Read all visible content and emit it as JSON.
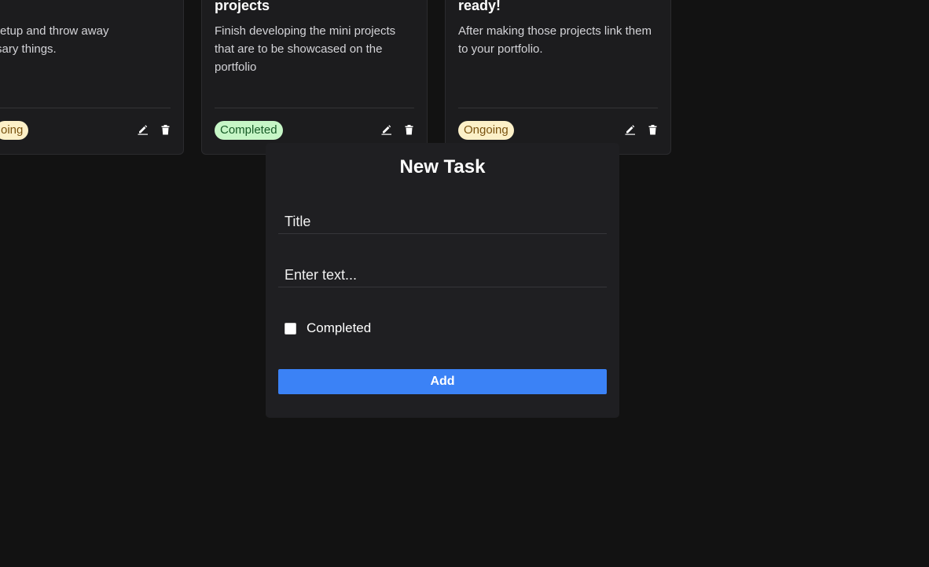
{
  "cards": [
    {
      "title": "",
      "description": "n the setup and throw away\nnecessary things.",
      "status": "oing",
      "status_type": "ongoing"
    },
    {
      "title": "projects",
      "description": "Finish developing the mini projects that are to be showcased on the portfolio",
      "status": "Completed",
      "status_type": "completed"
    },
    {
      "title": "ready!",
      "description": "After making those projects link them to your portfolio.",
      "status": "Ongoing",
      "status_type": "ongoing"
    }
  ],
  "icons": {
    "edit": "pencil-icon",
    "delete": "trash-icon"
  },
  "modal": {
    "title": "New Task",
    "title_placeholder": "Title",
    "title_value": "",
    "text_placeholder": "Enter text...",
    "text_value": "",
    "completed_label": "Completed",
    "completed_checked": false,
    "add_label": "Add"
  },
  "colors": {
    "background": "#121212",
    "card": "#1c1c1e",
    "modal": "#1f1f22",
    "accent": "#3b82f6",
    "badge_completed_bg": "#c6f6c6",
    "badge_ongoing_bg": "#fcf0c8"
  }
}
